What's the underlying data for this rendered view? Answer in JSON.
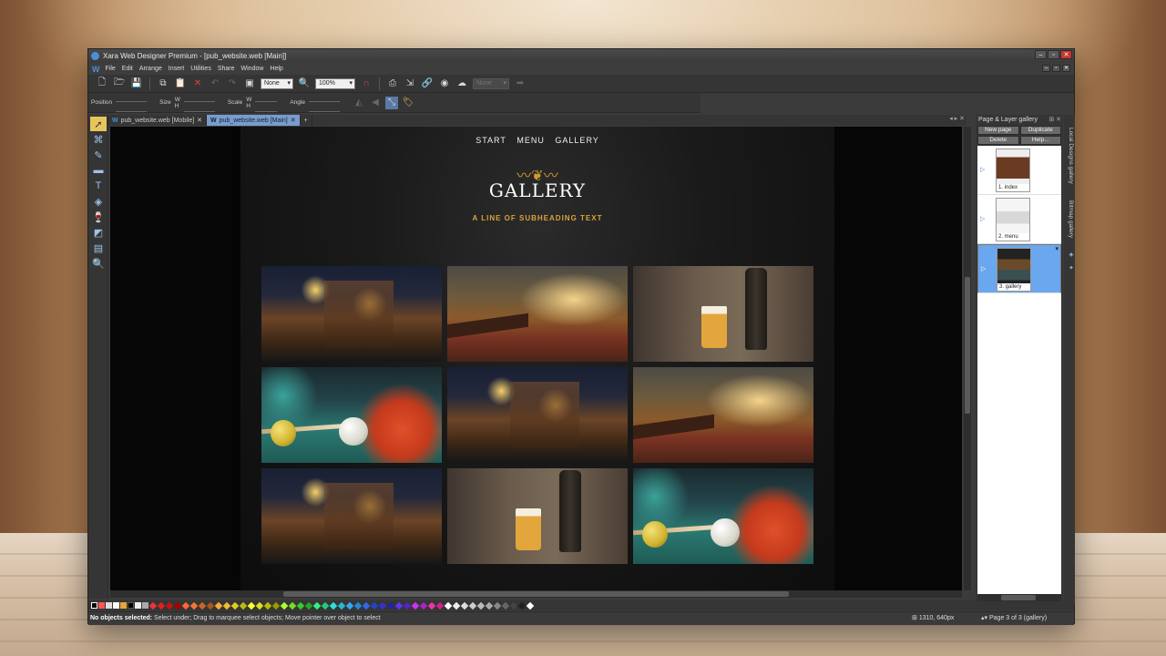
{
  "window": {
    "title": "Xara Web Designer Premium - [pub_website.web [Main]]"
  },
  "menu": [
    "File",
    "Edit",
    "Arrange",
    "Insert",
    "Utilities",
    "Share",
    "Window",
    "Help"
  ],
  "toolbar": {
    "fill_select": "None",
    "zoom_select": "100%",
    "disabled_select": "None"
  },
  "infobar": {
    "position_label": "Position",
    "size_label": "Size",
    "scale_label": "Scale",
    "angle_label": "Angle",
    "w": "W",
    "h": "H"
  },
  "tabs": [
    {
      "label": "pub_website.web [Mobile]",
      "active": false
    },
    {
      "label": "pub_website.web [Main]",
      "active": true
    }
  ],
  "site": {
    "nav": [
      "START",
      "MENU",
      "GALLERY"
    ],
    "heading": "GALLERY",
    "subheading": "A LINE OF SUBHEADING TEXT",
    "photos": [
      "pub",
      "bar",
      "beer",
      "pool",
      "pub",
      "bar",
      "pub",
      "beer",
      "pool"
    ]
  },
  "gallery_panel": {
    "title": "Page & Layer gallery",
    "buttons": [
      "New page",
      "Duplicate",
      "Delete",
      "Help..."
    ],
    "pages": [
      {
        "label": "1. index",
        "selected": false
      },
      {
        "label": "2. menu",
        "selected": false
      },
      {
        "label": "3. gallery",
        "selected": true
      }
    ],
    "side_tabs": [
      "Local Designs gallery",
      "Bitmap gallery"
    ]
  },
  "status": {
    "bold": "No objects selected:",
    "message": " Select under; Drag to marquee select objects; Move pointer over object to select",
    "coords": "1310, 640px",
    "page": "Page 3 of 3 (gallery)"
  },
  "colors": {
    "accent": "#4d8fd6",
    "gold": "#d9a23a",
    "palette": [
      "#e33",
      "#d22",
      "#c11",
      "#a00",
      "#f63",
      "#e73",
      "#c62",
      "#a52",
      "#fa3",
      "#eb3",
      "#dc2",
      "#bb1",
      "#ff3",
      "#dd2",
      "#bb0",
      "#990",
      "#af3",
      "#7d2",
      "#3c3",
      "#2a2",
      "#3e8",
      "#2c7",
      "#3dd",
      "#2bc",
      "#3ae",
      "#28d",
      "#36e",
      "#24c",
      "#33c",
      "#22a",
      "#63e",
      "#52c",
      "#c3e",
      "#a2c",
      "#e3a",
      "#c28",
      "#fff",
      "#eee",
      "#ddd",
      "#ccc",
      "#bbb",
      "#aaa",
      "#888",
      "#666",
      "#444",
      "#222",
      "#fff"
    ]
  }
}
